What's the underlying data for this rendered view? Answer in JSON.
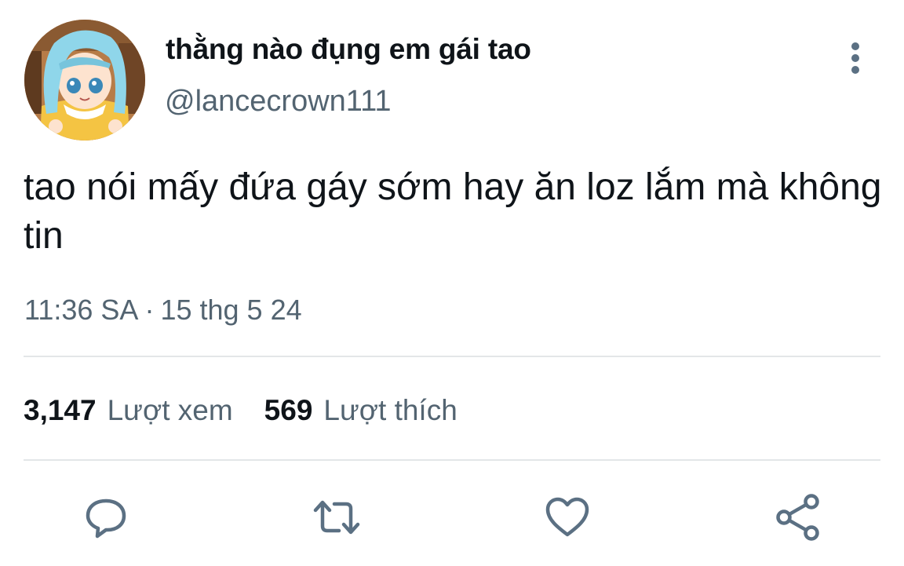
{
  "author": {
    "display_name": "thằng nào đụng em gái tao",
    "handle": "@lancecrown111",
    "avatar_icon": "anime-avatar"
  },
  "tweet": {
    "text": "tao nói mấy đứa gáy sớm hay ăn loz lắm mà không tin",
    "time": "11:36 SA",
    "separator": "·",
    "date": "15 thg 5 24"
  },
  "stats": {
    "views_count": "3,147",
    "views_label": "Lượt xem",
    "likes_count": "569",
    "likes_label": "Lượt thích"
  },
  "actions": {
    "reply_icon": "reply-icon",
    "retweet_icon": "retweet-icon",
    "like_icon": "heart-icon",
    "share_icon": "share-icon",
    "more_icon": "more-vertical-icon"
  },
  "colors": {
    "text_primary": "#0f1419",
    "text_secondary": "#536471",
    "icon": "#5b7083",
    "divider": "#e3e6e8"
  }
}
